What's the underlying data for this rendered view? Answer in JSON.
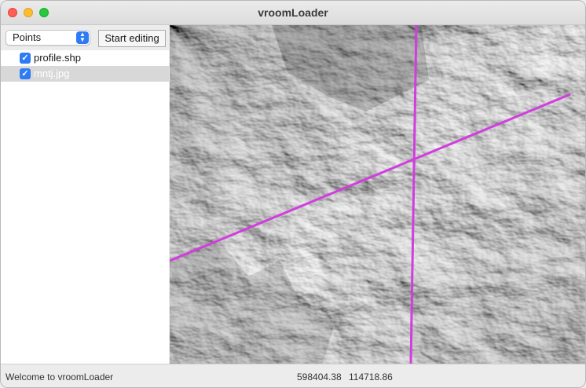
{
  "window": {
    "title": "vroomLoader"
  },
  "toolbar": {
    "mode_select_value": "Points",
    "start_editing_label": "Start editing"
  },
  "layers": [
    {
      "name": "profile.shp",
      "checked": true,
      "selected": false
    },
    {
      "name": "mntj.jpg",
      "checked": true,
      "selected": true
    }
  ],
  "map": {
    "image": "hillshade relief terrain (grayscale)",
    "profile_line_color": "#d23ce0"
  },
  "status": {
    "message": "Welcome to vroomLoader",
    "x": "598404.38",
    "y": "114718.86"
  },
  "colors": {
    "accent": "#2e7bf6",
    "close": "#fe5f57",
    "minimize": "#febc2e",
    "maximize": "#28c840"
  },
  "icons": {
    "checkbox": "checkmark-icon",
    "select_stepper": "chevron-updown-icon"
  }
}
